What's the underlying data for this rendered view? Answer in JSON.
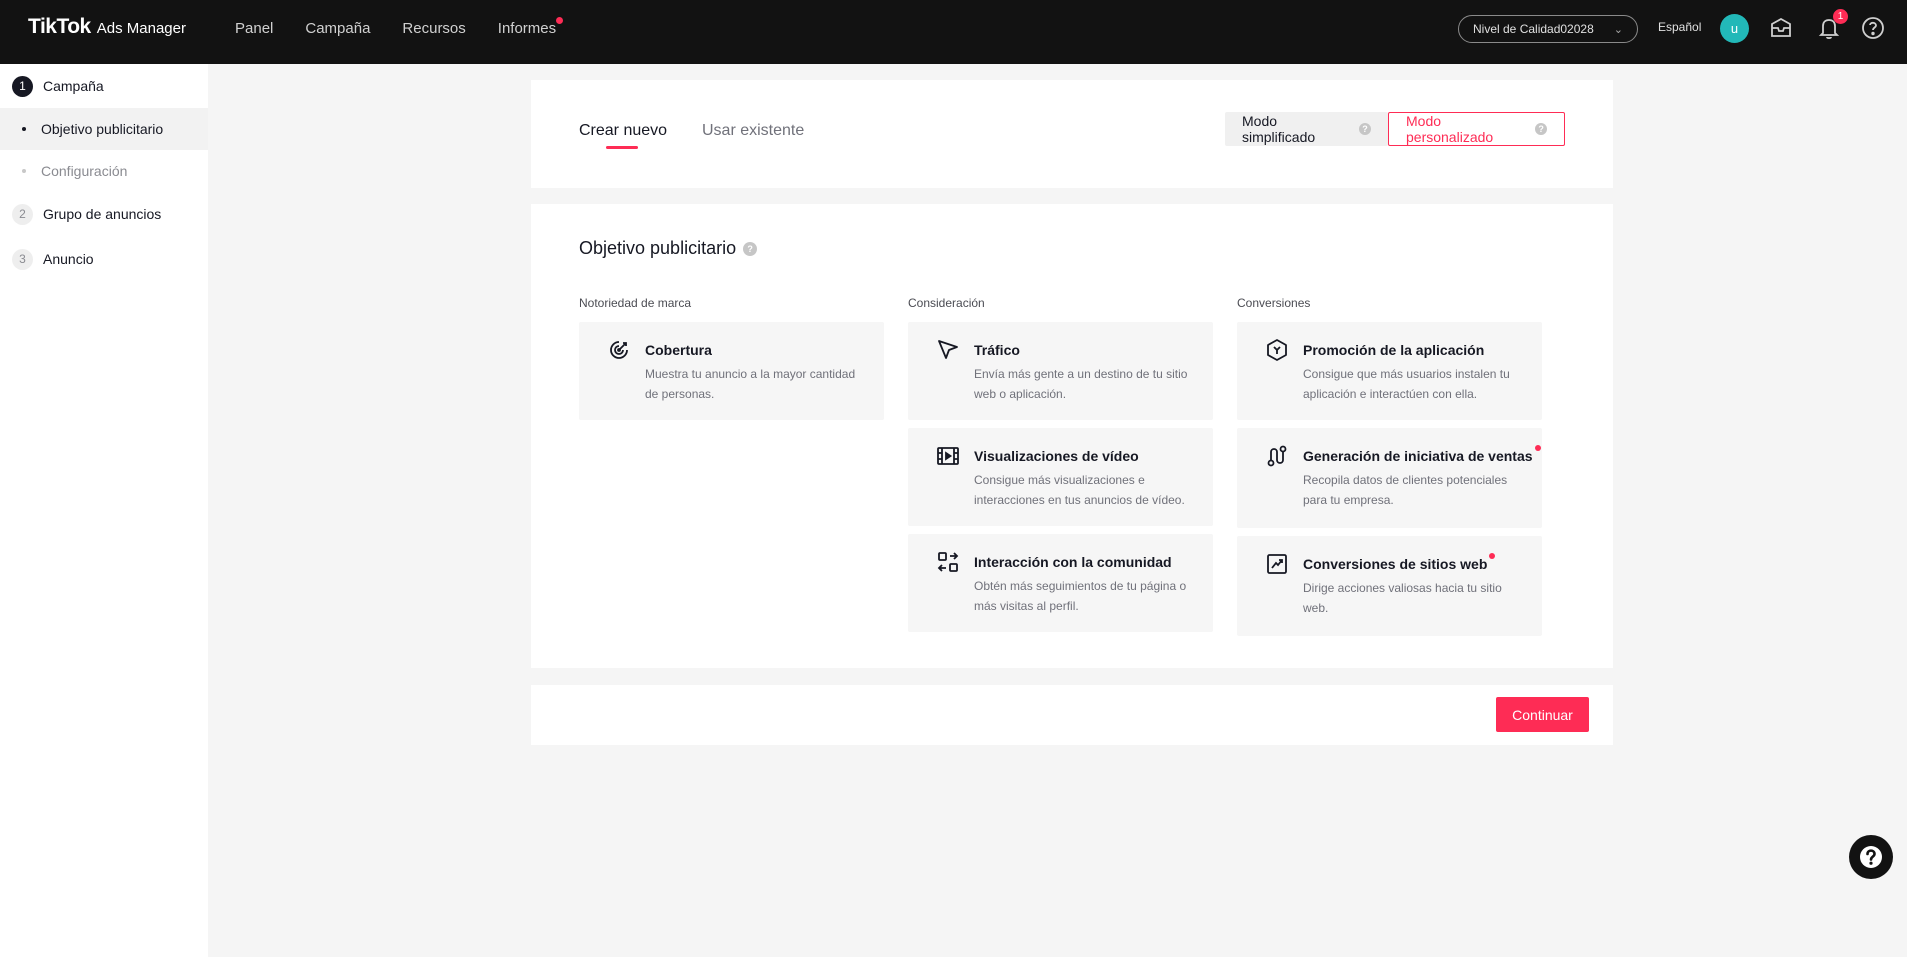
{
  "header": {
    "logo_main": "TikTok",
    "logo_sub": "Ads Manager",
    "nav": [
      "Panel",
      "Campaña",
      "Recursos",
      "Informes"
    ],
    "account": "Nivel de Calidad02028",
    "language": "Español",
    "avatar_initial": "u",
    "notification_count": "1"
  },
  "sidebar": {
    "step1": {
      "num": "1",
      "label": "Campaña"
    },
    "sub1": "Objetivo publicitario",
    "sub2": "Configuración",
    "step2": {
      "num": "2",
      "label": "Grupo de anuncios"
    },
    "step3": {
      "num": "3",
      "label": "Anuncio"
    }
  },
  "tabs": {
    "create": "Crear nuevo",
    "existing": "Usar existente"
  },
  "modes": {
    "simple": "Modo simplificado",
    "custom": "Modo personalizado"
  },
  "objective": {
    "title": "Objetivo publicitario",
    "columns": [
      "Notoriedad de marca",
      "Consideración",
      "Conversiones"
    ],
    "items": [
      {
        "name": "Cobertura",
        "desc": "Muestra tu anuncio a la mayor cantidad de personas.",
        "icon": "reach-icon"
      },
      {
        "name": "Tráfico",
        "desc": "Envía más gente a un destino de tu sitio web o aplicación.",
        "icon": "cursor-icon"
      },
      {
        "name": "Visualizaciones de vídeo",
        "desc": "Consigue más visualizaciones e interacciones en tus anuncios de vídeo.",
        "icon": "video-icon"
      },
      {
        "name": "Interacción con la comunidad",
        "desc": "Obtén más seguimientos de tu página o más visitas al perfil.",
        "icon": "community-icon"
      },
      {
        "name": "Promoción de la aplicación",
        "desc": "Consigue que más usuarios instalen tu aplicación e interactúen con ella.",
        "icon": "app-icon"
      },
      {
        "name": "Generación de iniciativa de ventas",
        "desc": "Recopila datos de clientes potenciales para tu empresa.",
        "icon": "lead-icon"
      },
      {
        "name": "Conversiones de sitios web",
        "desc": "Dirige acciones valiosas hacia tu sitio web.",
        "icon": "trend-icon"
      }
    ]
  },
  "footer": {
    "continue": "Continuar"
  },
  "colors": {
    "accent": "#fe2c55",
    "topbar": "#121212",
    "avatar": "#22b8b8"
  }
}
